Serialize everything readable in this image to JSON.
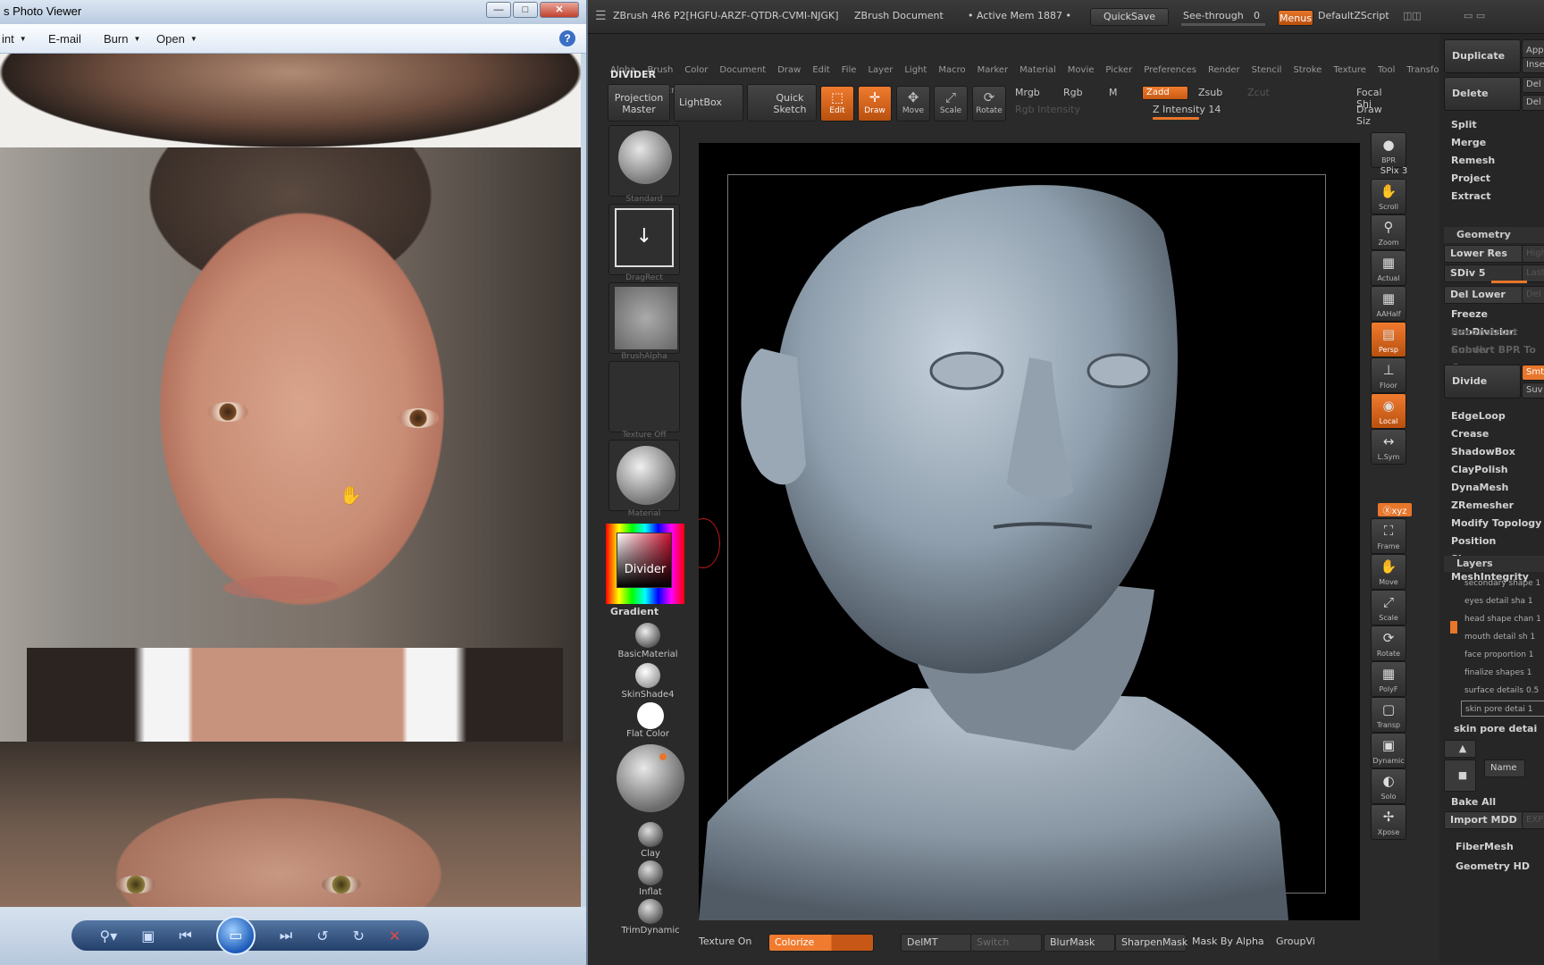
{
  "photo_viewer": {
    "title": "s Photo Viewer",
    "window_buttons": {
      "minimize": "—",
      "maximize": "□",
      "close": "✕"
    },
    "menu": [
      {
        "label": "int",
        "has_caret": true
      },
      {
        "label": "E-mail",
        "has_caret": false
      },
      {
        "label": "Burn",
        "has_caret": true
      },
      {
        "label": "Open",
        "has_caret": true
      }
    ],
    "help": "?",
    "controls": [
      "zoom-icon",
      "fit-window-icon",
      "previous-icon",
      "slideshow-icon",
      "next-icon",
      "rotate-ccw-icon",
      "rotate-cw-icon",
      "delete-icon"
    ]
  },
  "zbrush": {
    "title_left": "ZBrush 4R6 P2[HGFU-ARZF-QTDR-CVMI-NJGK]",
    "doc_title": "ZBrush Document",
    "active_mem": "• Active Mem 1887 •",
    "quicksave": "QuickSave",
    "see_through": "See-through",
    "see_through_value": "0",
    "menus": "Menus",
    "default_zscript": "DefaultZScript",
    "menu_row1": [
      "Alpha",
      "Brush",
      "Color",
      "Document",
      "Draw",
      "Edit",
      "File",
      "Layer",
      "Light",
      "Macro",
      "Marker",
      "Material",
      "Movie",
      "Picker",
      "Preferences",
      "Render",
      "Stencil",
      "Stroke",
      "Texture",
      "Tool",
      "Transform"
    ],
    "menu_row2": [
      "Zplugin",
      "Zscript"
    ],
    "palette_label": "DIVIDER",
    "shelf": {
      "projection_master": "Projection Master",
      "lightbox": "LightBox",
      "quick_sketch": "Quick Sketch",
      "tools": [
        {
          "label": "Edit",
          "active": true,
          "icon": "edit-icon"
        },
        {
          "label": "Draw",
          "active": true,
          "icon": "draw-icon"
        },
        {
          "label": "Move",
          "active": false,
          "icon": "move-icon"
        },
        {
          "label": "Scale",
          "active": false,
          "icon": "scale-icon"
        },
        {
          "label": "Rotate",
          "active": false,
          "icon": "rotate-icon"
        }
      ],
      "mrgb": "Mrgb",
      "rgb": "Rgb",
      "m": "M",
      "rgb_intensity": "Rgb Intensity",
      "zadd": "Zadd",
      "zsub": "Zsub",
      "zcut": "Zcut",
      "z_intensity": "Z Intensity 14",
      "focal_shift": "Focal Shi",
      "draw_size": "Draw Siz"
    },
    "left_tray": {
      "thumbs": [
        "Standard",
        "DragRect",
        "BrushAlpha",
        "Texture Off",
        "Gradient"
      ],
      "active_thumb": "Material",
      "color_label": "Divider",
      "gradient_label": "Gradient",
      "materials": [
        "BasicMaterial",
        "SkinShade4",
        "Flat Color"
      ],
      "brushes": [
        "Clay",
        "Inflat",
        "TrimDynamic"
      ]
    },
    "right_tray": [
      {
        "label": "BPR",
        "icon": "bpr-icon"
      },
      {
        "label": "Scroll",
        "icon": "scroll-icon"
      },
      {
        "label": "Zoom",
        "icon": "zoom-icon"
      },
      {
        "label": "Actual",
        "icon": "actual-icon"
      },
      {
        "label": "AAHalf",
        "icon": "aahalf-icon"
      },
      {
        "label": "Persp",
        "icon": "persp-icon",
        "active": true
      },
      {
        "label": "Floor",
        "icon": "floor-icon"
      },
      {
        "label": "Local",
        "icon": "local-icon",
        "active": true
      },
      {
        "label": "L.Sym",
        "icon": "lsym-icon"
      },
      {
        "label": "Frame",
        "icon": "frame-icon"
      },
      {
        "label": "Move",
        "icon": "move-icon"
      },
      {
        "label": "Scale",
        "icon": "scale-icon"
      },
      {
        "label": "Rotate",
        "icon": "rotate-icon"
      },
      {
        "label": "PolyF",
        "icon": "polyf-icon"
      },
      {
        "label": "Transp",
        "icon": "transp-icon"
      },
      {
        "label": "Dynamic",
        "icon": "dynamic-icon"
      },
      {
        "label": "Solo",
        "icon": "solo-icon"
      },
      {
        "label": "Xpose",
        "icon": "xpose-icon"
      }
    ],
    "spix": "SPix 3",
    "xyz": "Ⓧxyz",
    "bottom_shelf": {
      "texture_on": "Texture On",
      "colorize": "Colorize",
      "delmt": "DelMT",
      "switch": "Switch",
      "blurmask": "BlurMask",
      "sharpenmask": "SharpenMask",
      "mask_by_alpha": "Mask By Alpha",
      "groupvi": "GroupVi"
    },
    "subtool": {
      "duplicate": "Duplicate",
      "append": "App",
      "insert": "Inse",
      "delete": "Delete",
      "del": "Del",
      "del2": "Del",
      "split": "Split",
      "merge": "Merge",
      "remesh": "Remesh",
      "project": "Project",
      "extract": "Extract"
    },
    "geometry": {
      "header": "Geometry",
      "lower_res": "Lower Res",
      "higher": "High",
      "sdiv": "SDiv 5",
      "last": "Last",
      "del_lower": "Del Lower",
      "del_higher": "Del",
      "freeze": "Freeze SubDivision",
      "reconstruct": "Reconstruct Subdiv",
      "convert": "Convert BPR To G",
      "divide": "Divide",
      "smt": "Smt",
      "suv": "Suv",
      "items": [
        "EdgeLoop",
        "Crease",
        "ShadowBox",
        "ClayPolish",
        "DynaMesh",
        "ZRemesher",
        "Modify Topology",
        "Position",
        "Size",
        "MeshIntegrity"
      ]
    },
    "layers": {
      "header": "Layers",
      "items": [
        "secondary shape 1",
        "eyes detail sha 1",
        "head shape chan 1",
        "mouth detail sh 1",
        "face proportion 1",
        "finalize shapes 1",
        "surface details 0.5",
        "skin pore detai 1"
      ],
      "selected_name": "skin pore detai 1",
      "name_btn": "Name",
      "bake_all": "Bake All",
      "import_mdd": "Import MDD",
      "export": "EXP"
    },
    "fibermesh": "FiberMesh",
    "geometry_hd": "Geometry HD"
  }
}
